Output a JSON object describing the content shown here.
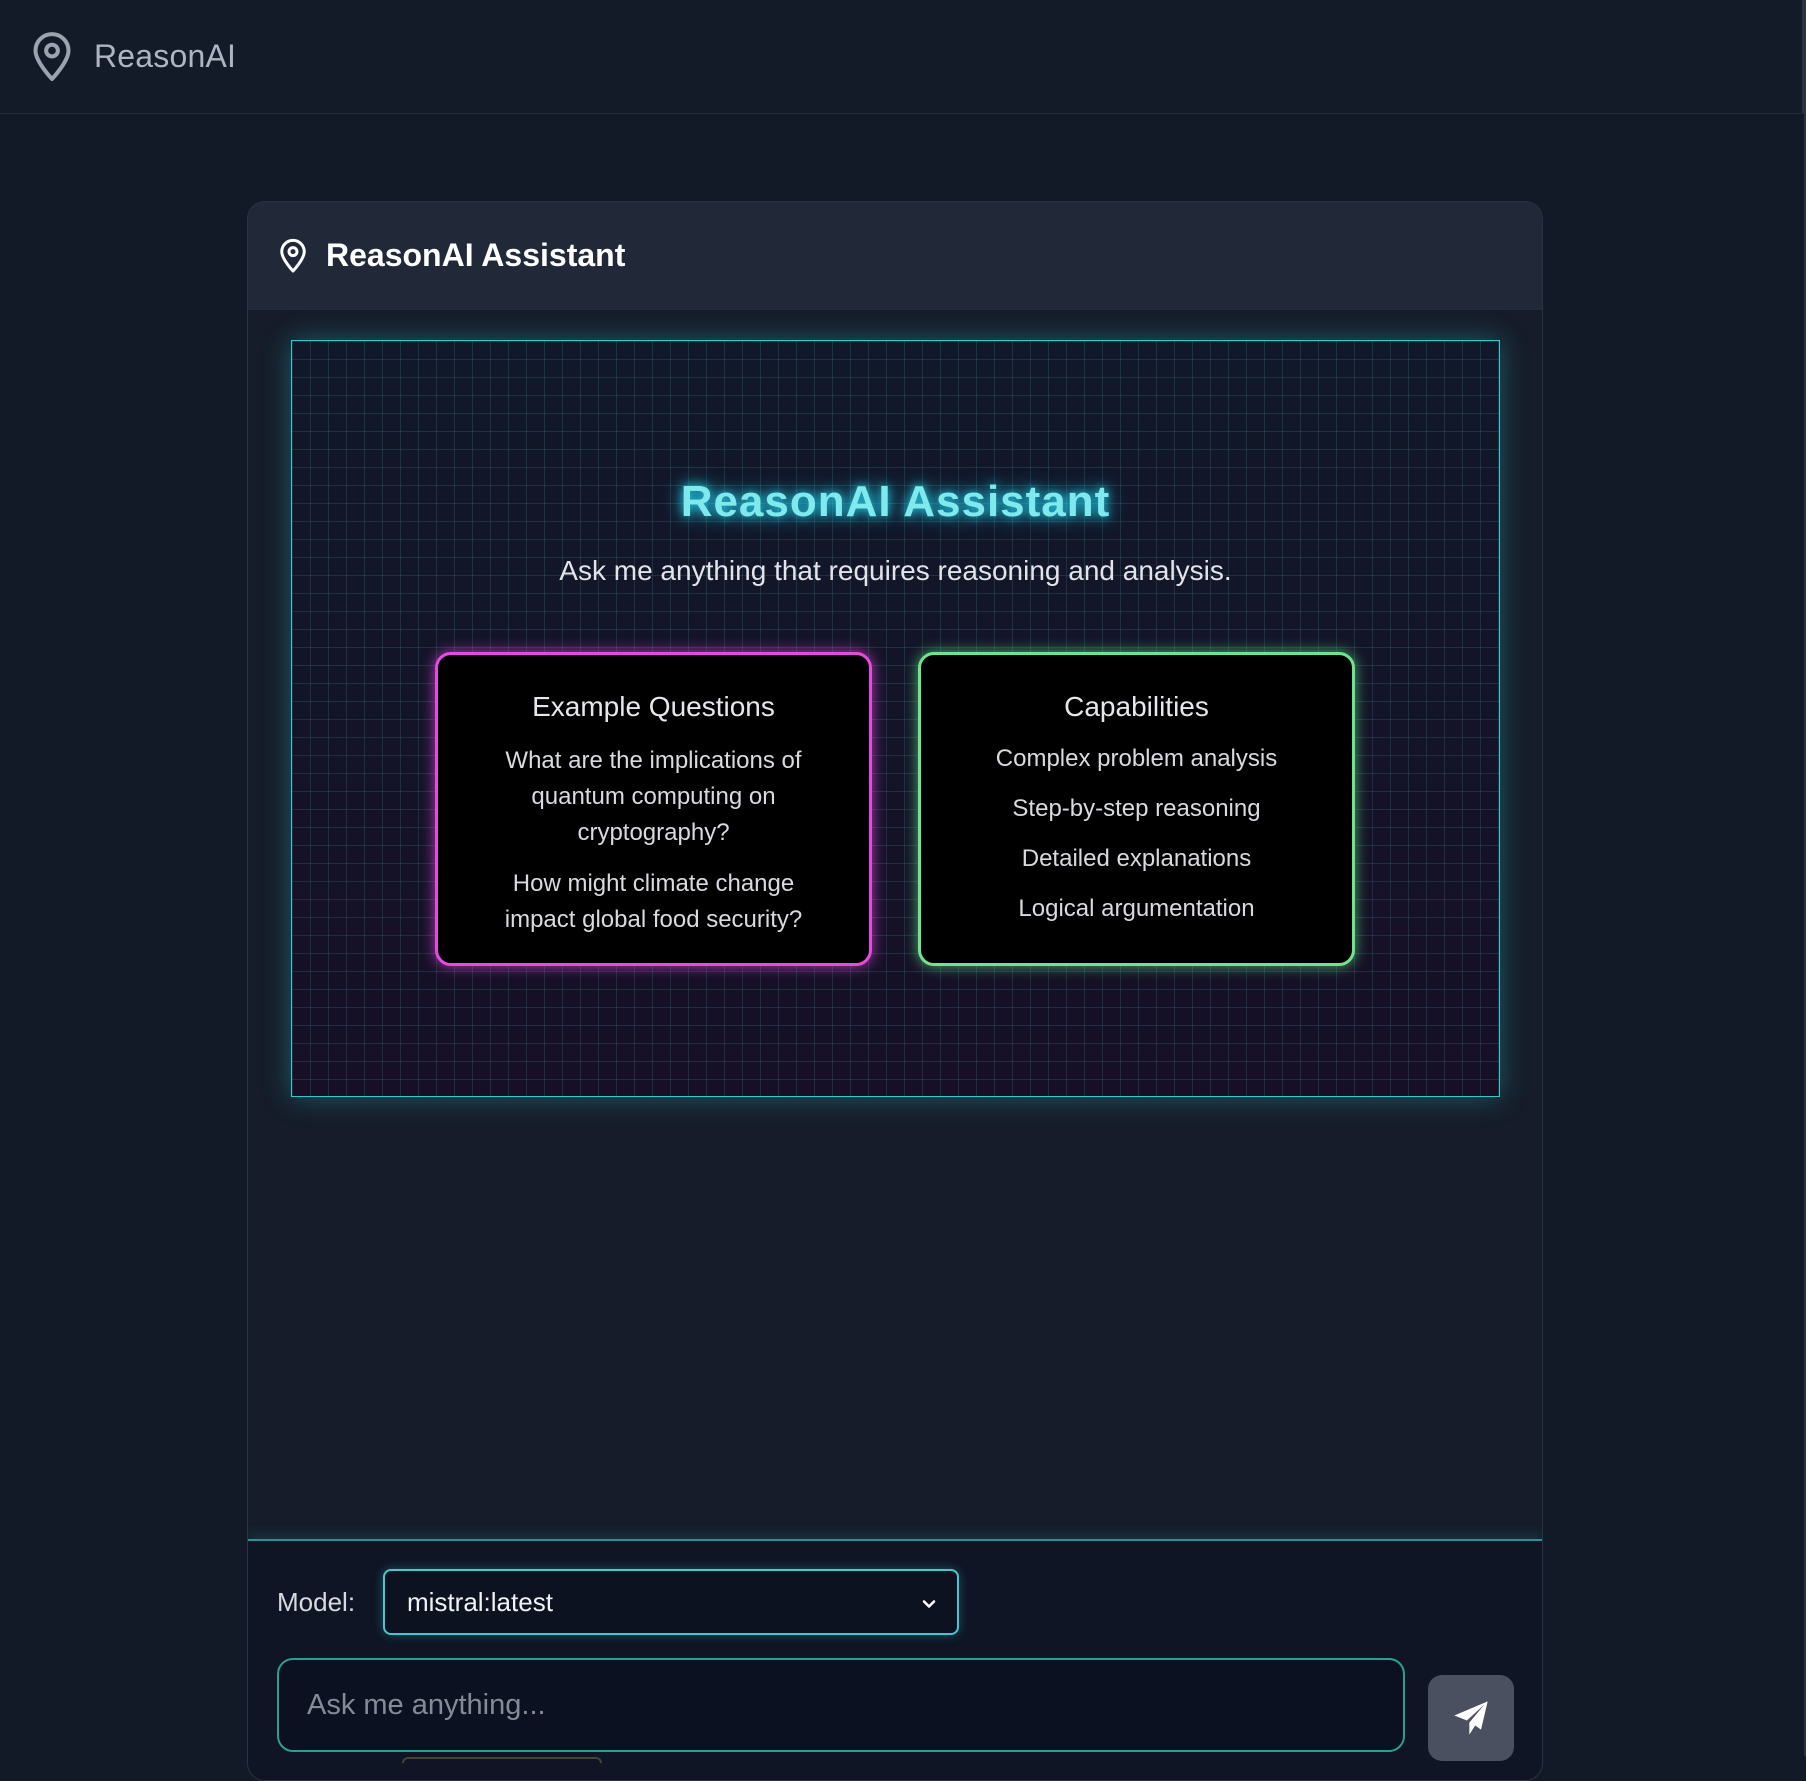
{
  "app": {
    "brand": "ReasonAI",
    "brand_icon": "map-pin-icon"
  },
  "card": {
    "title": "ReasonAI Assistant",
    "title_icon": "map-pin-icon"
  },
  "welcome": {
    "title": "ReasonAI Assistant",
    "subtitle": "Ask me anything that requires reasoning and analysis.",
    "examples": {
      "title": "Example Questions",
      "items": [
        "What are the implications of quantum computing on cryptography?",
        "How might climate change impact global food security?"
      ],
      "accent": "#e24ddf"
    },
    "capabilities": {
      "title": "Capabilities",
      "items": [
        "Complex problem analysis",
        "Step-by-step reasoning",
        "Detailed explanations",
        "Logical argumentation"
      ],
      "accent": "#6fe38e"
    },
    "title_color": "#7fe9ee"
  },
  "input": {
    "model_label": "Model:",
    "model_value": "mistral:latest",
    "placeholder": "Ask me anything...",
    "value": "",
    "send_icon": "send-icon"
  }
}
